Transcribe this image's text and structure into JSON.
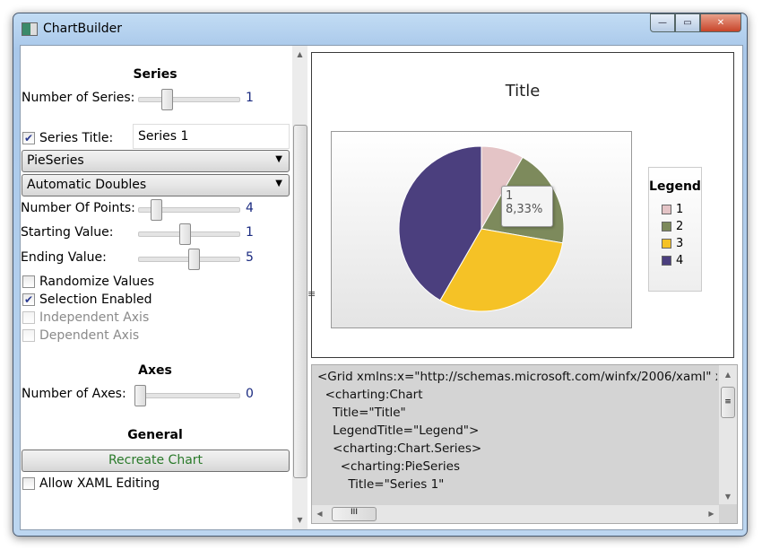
{
  "window": {
    "title": "ChartBuilder",
    "minimize": "—",
    "maximize": "▭",
    "close": "✕"
  },
  "left": {
    "series_heading": "Series",
    "num_series_label": "Number of Series:",
    "num_series_value": "1",
    "num_series_level": 0.3,
    "series_title_label": "Series Title:",
    "series_title_checked": true,
    "series_title_value": "Series 1",
    "series_type": "PieSeries",
    "data_source": "Automatic Doubles",
    "num_points_label": "Number Of Points:",
    "num_points_value": "4",
    "num_points_level": 0.18,
    "start_label": "Starting Value:",
    "start_value": "1",
    "start_level": 0.5,
    "end_label": "Ending Value:",
    "end_value": "5",
    "end_level": 0.6,
    "randomize_label": "Randomize Values",
    "randomize_checked": false,
    "selection_label": "Selection Enabled",
    "selection_checked": true,
    "indep_label": "Independent Axis",
    "dep_label": "Dependent Axis",
    "axes_heading": "Axes",
    "num_axes_label": "Number of Axes:",
    "num_axes_value": "0",
    "num_axes_level": 0,
    "general_heading": "General",
    "recreate_label": "Recreate Chart",
    "allow_xaml_label": "Allow XAML Editing",
    "allow_xaml_checked": false
  },
  "chart": {
    "title": "Title",
    "legend_title": "Legend",
    "slices": [
      {
        "label": "1",
        "value": 1,
        "color": "#e4c4c6"
      },
      {
        "label": "2",
        "value": 2.33,
        "color": "#7d8a5c"
      },
      {
        "label": "3",
        "value": 3.67,
        "color": "#f5c226"
      },
      {
        "label": "4",
        "value": 5,
        "color": "#4b3f7e"
      }
    ],
    "tooltip": {
      "label": "1",
      "percent": "8,33%"
    }
  },
  "xaml": {
    "lines": [
      "<Grid xmlns:x=\"http://schemas.microsoft.com/winfx/2006/xaml\" xm",
      "  <charting:Chart",
      "    Title=\"Title\"",
      "    LegendTitle=\"Legend\">",
      "    <charting:Chart.Series>",
      "      <charting:PieSeries",
      "        Title=\"Series 1\""
    ]
  }
}
